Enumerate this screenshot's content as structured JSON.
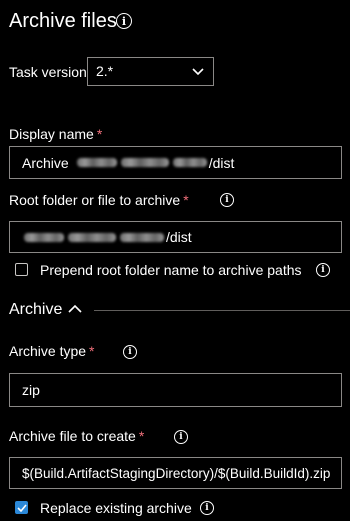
{
  "header": {
    "title": "Archive files",
    "info_icon": "info-icon"
  },
  "task_version": {
    "label": "Task version",
    "value": "2.*",
    "icon": "chevron-down-icon"
  },
  "display_name": {
    "label": "Display name",
    "required_mark": "*",
    "value_prefix": "Archive",
    "value_suffix": "/dist"
  },
  "root_folder": {
    "label": "Root folder or file to archive",
    "required_mark": "*",
    "info_icon": "info-icon",
    "value_suffix": "/dist"
  },
  "prepend_root": {
    "label": "Prepend root folder name to archive paths",
    "checked": false,
    "info_icon": "info-icon"
  },
  "archive_section": {
    "title": "Archive",
    "icon": "chevron-up-icon"
  },
  "archive_type": {
    "label": "Archive type",
    "required_mark": "*",
    "info_icon": "info-icon",
    "value": "zip"
  },
  "archive_file": {
    "label": "Archive file to create",
    "required_mark": "*",
    "info_icon": "info-icon",
    "value": "$(Build.ArtifactStagingDirectory)/$(Build.BuildId).zip"
  },
  "replace_existing": {
    "label": "Replace existing archive",
    "checked": true,
    "info_icon": "info-icon"
  },
  "colors": {
    "background": "#000000",
    "text": "#ffffff",
    "required": "#f1707b",
    "border": "#8a8886",
    "checkbox_checked": "#2b88d8"
  }
}
